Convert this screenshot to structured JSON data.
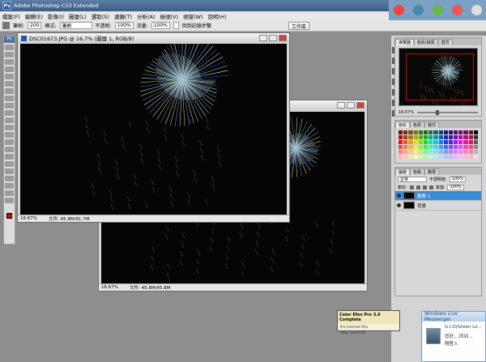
{
  "app": {
    "logo": "Ps",
    "title": "Adobe Photoshop CS3 Extended"
  },
  "menu": [
    "檔案(F)",
    "編輯(E)",
    "影像(I)",
    "圖層(L)",
    "選取(S)",
    "濾鏡(T)",
    "分析(A)",
    "檢視(V)",
    "視窗(W)",
    "說明(H)"
  ],
  "options": {
    "brush_label": "筆刷:",
    "brush_size": "200",
    "mode_label": "模式:",
    "mode_value": "筆刷",
    "opacity_label": "不透明:",
    "opacity_value": "100%",
    "flow_label": "流量:",
    "flow_value": "100%",
    "history_label": "回到記錄步驟",
    "workspace": "工作區"
  },
  "doc_front": {
    "title": "DSC01673.JPG @ 16.7% (圖層 1, RGB/8)",
    "zoom": "16.67%",
    "file_info": "文件: 45.8M/91.7M"
  },
  "doc_back": {
    "zoom": "16.67%",
    "file_info": "文件: 45.8M/45.8M"
  },
  "navigator": {
    "tabs": [
      "導覽器",
      "色彩/資訊",
      "直方"
    ],
    "zoom": "16.67%"
  },
  "swatches": {
    "tabs": [
      "色彩",
      "色票",
      "樣式"
    ]
  },
  "layers": {
    "tabs": [
      "圖層",
      "色版",
      "路徑"
    ],
    "blend_mode": "正常",
    "opacity_label": "不透明度:",
    "opacity_value": "100%",
    "lock_label": "鎖定:",
    "fill_label": "填滿:",
    "fill_value": "100%",
    "items": [
      {
        "name": "圖層 1",
        "selected": true
      },
      {
        "name": "背景",
        "selected": false
      }
    ]
  },
  "efex": {
    "title": "Color Efex Pro 3.0 Complete",
    "line1": "Pro Contrast Film",
    "line2": "Help Cancel OK"
  },
  "msn": {
    "header": "Windows Live Messenger",
    "name": "G.I.O(Green Lo...",
    "msg1": "您好....同到...",
    "msg2": "剛登入"
  },
  "colors": {
    "accent": "#3c8bd6",
    "foreground": "#d40000",
    "canvas": "#050505"
  }
}
